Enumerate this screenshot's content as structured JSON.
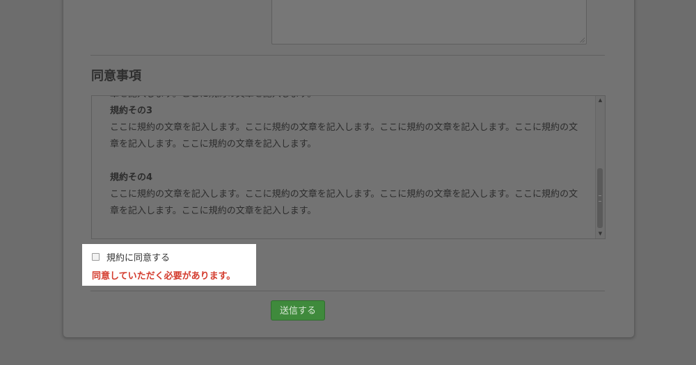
{
  "section": {
    "title": "同意事項"
  },
  "terms": {
    "partial_line": "章を記入します。ここに規約の文章を記入します。",
    "items": [
      {
        "title": "規約その3",
        "line1": "ここに規約の文章を記入します。ここに規約の文章を記入します。ここに規約の文章を記入します。ここに規約の文",
        "line2": "章を記入します。ここに規約の文章を記入します。"
      },
      {
        "title": "規約その4",
        "line1": "ここに規約の文章を記入します。ここに規約の文章を記入します。ここに規約の文章を記入します。ここに規約の文",
        "line2": "章を記入します。ここに規約の文章を記入します。"
      }
    ],
    "scroll_position": 0.75
  },
  "agree": {
    "label": "規約に同意する",
    "checked": false,
    "error": "同意していただく必要があります。"
  },
  "submit": {
    "label": "送信する"
  },
  "colors": {
    "overlay": "#6d6d6d",
    "error": "#d33a2c",
    "submit_bg": "#3f8a3c"
  },
  "icons": {
    "scroll_up": "▲",
    "scroll_down": "▼"
  }
}
